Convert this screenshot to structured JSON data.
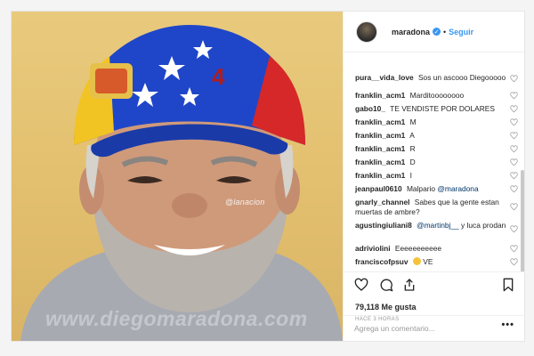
{
  "post": {
    "photo": {
      "watermark_small": "@lanacion",
      "watermark_large": "www.diegomaradona.com"
    },
    "header": {
      "username": "maradona",
      "verified_icon": "verified-badge-icon",
      "separator": "•",
      "follow_label": "Seguir"
    },
    "comments": [
      {
        "user": "pura__vida_love",
        "text": "Sos un ascooo Diegooooo"
      },
      {
        "user": "franklin_acm1",
        "text": "Marditoooooooo"
      },
      {
        "user": "gabo10_",
        "text": "TE VENDISTE POR DOLARES"
      },
      {
        "user": "franklin_acm1",
        "text": "M"
      },
      {
        "user": "franklin_acm1",
        "text": "A"
      },
      {
        "user": "franklin_acm1",
        "text": "R"
      },
      {
        "user": "franklin_acm1",
        "text": "D"
      },
      {
        "user": "franklin_acm1",
        "text": "I"
      },
      {
        "user": "jeanpaul0610",
        "text": "Malpario",
        "mention": "@maradona"
      },
      {
        "user": "gnarly_channel",
        "text": "Sabes que la gente estan muertas de ambre?"
      },
      {
        "user": "agustingiuliani8",
        "mention": "@martinbj__",
        "text": "y luca prodan"
      },
      {
        "user": "adriviolini",
        "text": "Eeeeeeeeeee"
      },
      {
        "user": "franciscofpsuv",
        "text": "VE",
        "emoji_icon": "strong-arm-emoji-icon"
      }
    ],
    "actions": {
      "like_icon": "heart-icon",
      "comment_icon": "comment-icon",
      "share_icon": "share-icon",
      "save_icon": "bookmark-icon"
    },
    "likes": "79,118 Me gusta",
    "time": "HACE 3 HORAS",
    "add_comment": {
      "placeholder": "Agrega un comentario...",
      "more_label": "•••"
    },
    "colors": {
      "link_blue": "#3897f0",
      "mention_blue": "#003569",
      "background_yellow": "#e2bf6e"
    }
  }
}
